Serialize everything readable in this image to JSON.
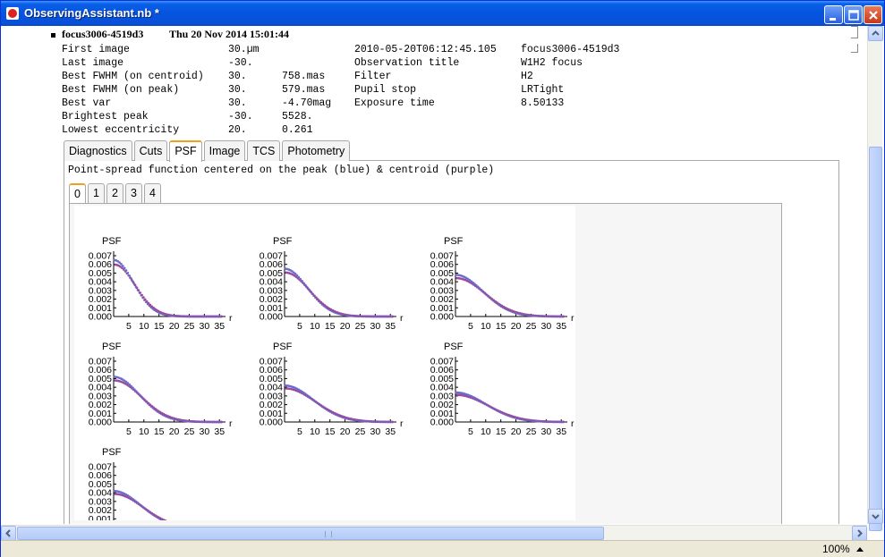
{
  "window": {
    "title": "ObservingAssistant.nb *"
  },
  "section": {
    "title": "focus3006-4519d3",
    "date": "Thu 20 Nov 2014 15:01:44"
  },
  "info_left": [
    {
      "label": "First image",
      "v1": "30.µm",
      "v2": ""
    },
    {
      "label": "Last image",
      "v1": "-30.",
      "v2": ""
    },
    {
      "label": "Best FWHM (on centroid)",
      "v1": "30.",
      "v2": "758.mas"
    },
    {
      "label": "Best FWHM (on peak)",
      "v1": "30.",
      "v2": "579.mas"
    },
    {
      "label": "Best var",
      "v1": "30.",
      "v2": "-4.70mag"
    },
    {
      "label": "Brightest peak",
      "v1": "-30.",
      "v2": "5528."
    },
    {
      "label": "Lowest eccentricity",
      "v1": "20.",
      "v2": "0.261"
    }
  ],
  "info_right": [
    {
      "label": "2010-05-20T06:12:45.105",
      "value": "focus3006-4519d3"
    },
    {
      "label": "Observation title",
      "value": "W1H2 focus"
    },
    {
      "label": "Filter",
      "value": "H2"
    },
    {
      "label": "Pupil stop",
      "value": "LRTight"
    },
    {
      "label": "Exposure time",
      "value": "8.50133"
    }
  ],
  "tabs": [
    "Diagnostics",
    "Cuts",
    "PSF",
    "Image",
    "TCS",
    "Photometry"
  ],
  "active_tab": "PSF",
  "psf_caption": "Point-spread function centered on the peak (blue) & centroid (purple)",
  "subtabs": [
    "0",
    "1",
    "2",
    "3",
    "4"
  ],
  "active_subtab": "0",
  "status": {
    "zoom": "100%"
  },
  "colors": {
    "peak": "#6A6ACF",
    "centroid": "#9A4A9A"
  },
  "chart_data": {
    "type": "scatter",
    "plot_label": "PSF",
    "xlabel": "r",
    "x_ticks": [
      5,
      10,
      15,
      20,
      25,
      30,
      35
    ],
    "y_ticks": [
      "0.000",
      "0.001",
      "0.002",
      "0.003",
      "0.004",
      "0.005",
      "0.006",
      "0.007"
    ],
    "xlim": [
      0,
      37
    ],
    "ylim": [
      0,
      0.007
    ],
    "panels": [
      {
        "peak": 0.0065,
        "width": 6.5
      },
      {
        "peak": 0.0055,
        "width": 7.5
      },
      {
        "peak": 0.0048,
        "width": 9.0
      },
      {
        "peak": 0.0052,
        "width": 8.5
      },
      {
        "peak": 0.0042,
        "width": 9.5
      },
      {
        "peak": 0.0034,
        "width": 10.0
      },
      {
        "peak": 0.0042,
        "width": 9.0
      }
    ]
  }
}
